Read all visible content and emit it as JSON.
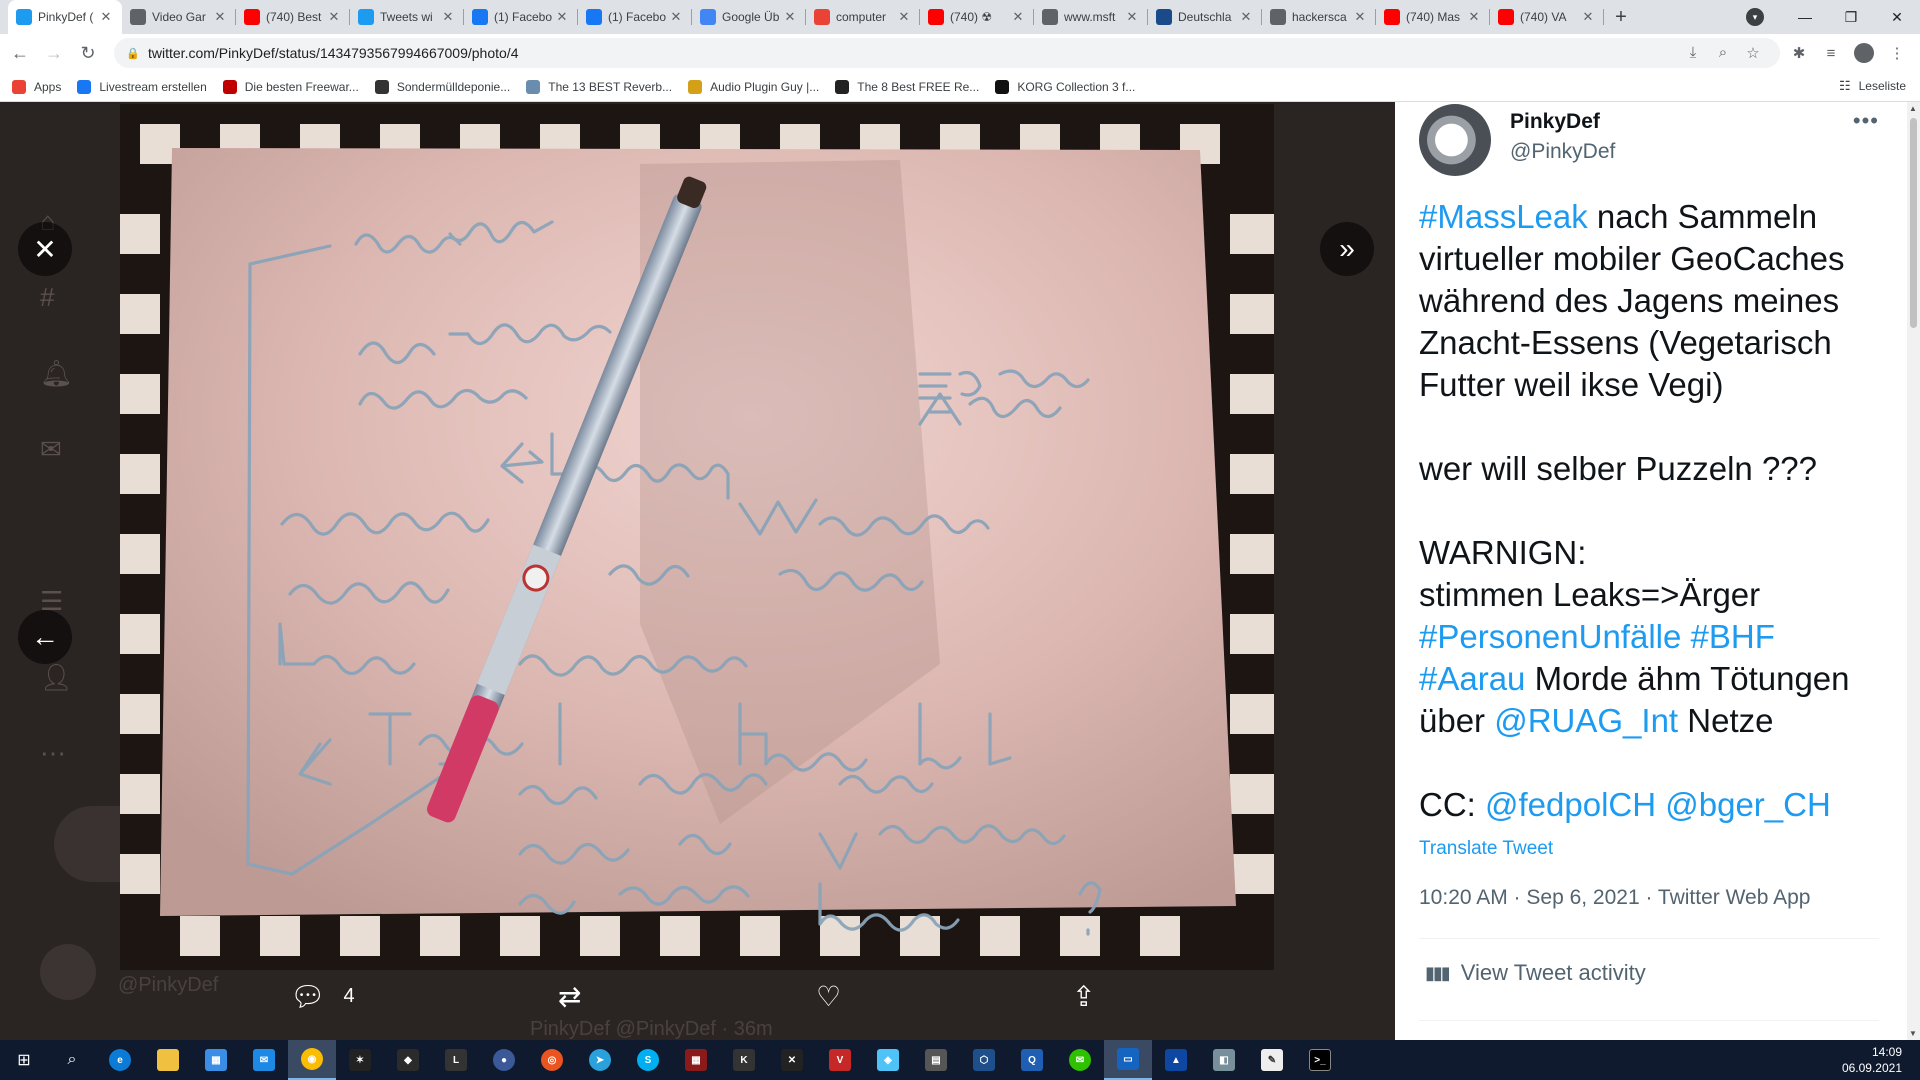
{
  "browser": {
    "tabs": [
      {
        "label": "PinkyDef (",
        "color": "#1d9bf0",
        "icon": "twitter-icon",
        "active": true
      },
      {
        "label": "Video Gar",
        "color": "#5f6368",
        "icon": "video-icon"
      },
      {
        "label": "(740) Best",
        "color": "#ff0000",
        "icon": "youtube-icon"
      },
      {
        "label": "Tweets wi",
        "color": "#1d9bf0",
        "icon": "twitter-icon"
      },
      {
        "label": "(1) Facebo",
        "color": "#1877f2",
        "icon": "facebook-icon"
      },
      {
        "label": "(1) Facebo",
        "color": "#1877f2",
        "icon": "facebook-icon"
      },
      {
        "label": "Google Üb",
        "color": "#4285f4",
        "icon": "google-translate-icon"
      },
      {
        "label": "computer",
        "color": "#ea4335",
        "icon": "google-icon"
      },
      {
        "label": "(740) ☢ ",
        "color": "#ff0000",
        "icon": "youtube-icon"
      },
      {
        "label": "www.msft",
        "color": "#5f6368",
        "icon": "globe-icon"
      },
      {
        "label": "Deutschla",
        "color": "#1a4a8a",
        "icon": "lz-icon"
      },
      {
        "label": "hackersca",
        "color": "#5f6368",
        "icon": "globe-icon"
      },
      {
        "label": "(740) Mas",
        "color": "#ff0000",
        "icon": "youtube-icon"
      },
      {
        "label": "(740) VA",
        "color": "#ff0000",
        "icon": "youtube-icon"
      }
    ],
    "url": "twitter.com/PinkyDef/status/1434793567994667009/photo/4",
    "bookmarks": [
      {
        "label": "Apps",
        "color": "#ea4335"
      },
      {
        "label": "Livestream erstellen",
        "color": "#1877f2"
      },
      {
        "label": "Die besten Freewar...",
        "color": "#c00000"
      },
      {
        "label": "Sondermülldeponie...",
        "color": "#333333"
      },
      {
        "label": "The 13 BEST Reverb...",
        "color": "#6a8caf"
      },
      {
        "label": "Audio Plugin Guy |...",
        "color": "#d4a017"
      },
      {
        "label": "The 8 Best FREE Re...",
        "color": "#222222"
      },
      {
        "label": "KORG Collection 3 f...",
        "color": "#111111"
      }
    ],
    "reading_list": "Leseliste"
  },
  "viewer": {
    "actions": {
      "replies": "4"
    },
    "ghost": {
      "handle": "@PinkyDef",
      "reply_author": "PinkyDef @PinkyDef · 36m"
    }
  },
  "tweet": {
    "display_name": "PinkyDef",
    "handle": "@PinkyDef",
    "more": "•••",
    "p1": {
      "hash1": "#MassLeak",
      "text1": " nach Sammeln virtueller mobiler GeoCaches während des Jagens meines Znacht-Essens (Vegetarisch Futter weil ikse Vegi)"
    },
    "p2": "wer will selber Puzzeln ???",
    "p3": {
      "warn": "WARNIGN:",
      "line": "stimmen Leaks=>Ärger ",
      "hash2": "#PersonenUnfälle",
      "sp1": " ",
      "hash3": "#BHF",
      "sp2": " ",
      "hash4": "#Aarau",
      "text2": " Morde ähm Tötungen über ",
      "mention1": "@RUAG_Int",
      "text3": " Netze"
    },
    "p4": {
      "cc": "CC: ",
      "mention2": "@fedpolCH",
      "sp": " ",
      "mention3": "@bger_CH"
    },
    "translate": "Translate Tweet",
    "meta": "10:20 AM · Sep 6, 2021 · Twitter Web App",
    "activity": "View Tweet activity"
  },
  "taskbar": {
    "time": "14:09",
    "date": "06.09.2021"
  }
}
